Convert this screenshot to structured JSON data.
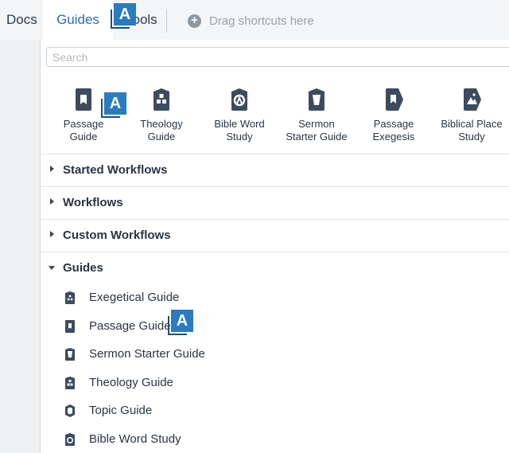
{
  "toolbar": {
    "tabs": [
      {
        "label": "Docs"
      },
      {
        "label": "Guides"
      },
      {
        "label": "Tools"
      }
    ],
    "drag_placeholder": "Drag shortcuts here",
    "badge_letter": "A"
  },
  "panel": {
    "search_placeholder": "Search",
    "guide_icons": [
      {
        "label": "Passage\nGuide",
        "icon": "passage-guide-icon"
      },
      {
        "label": "Theology\nGuide",
        "icon": "theology-guide-icon"
      },
      {
        "label": "Bible Word\nStudy",
        "icon": "bible-word-study-icon"
      },
      {
        "label": "Sermon\nStarter Guide",
        "icon": "sermon-starter-guide-icon"
      },
      {
        "label": "Passage\nExegesis",
        "icon": "passage-exegesis-icon"
      },
      {
        "label": "Biblical Place\nStudy",
        "icon": "biblical-place-study-icon"
      }
    ],
    "sections": [
      {
        "title": "Started Workflows",
        "expanded": false
      },
      {
        "title": "Workflows",
        "expanded": false
      },
      {
        "title": "Custom Workflows",
        "expanded": false
      },
      {
        "title": "Guides",
        "expanded": true
      }
    ],
    "guide_items": [
      {
        "label": "Exegetical Guide",
        "icon": "exegetical-guide-icon"
      },
      {
        "label": "Passage Guide",
        "icon": "passage-guide-icon"
      },
      {
        "label": "Sermon Starter Guide",
        "icon": "sermon-starter-guide-icon"
      },
      {
        "label": "Theology Guide",
        "icon": "theology-guide-icon"
      },
      {
        "label": "Topic Guide",
        "icon": "topic-guide-icon"
      },
      {
        "label": "Bible Word Study",
        "icon": "bible-word-study-icon"
      }
    ]
  },
  "colors": {
    "icon_dark": "#3d4b5f",
    "active_tab": "#2a6fb0",
    "badge_blue": "#2a7bbf"
  }
}
